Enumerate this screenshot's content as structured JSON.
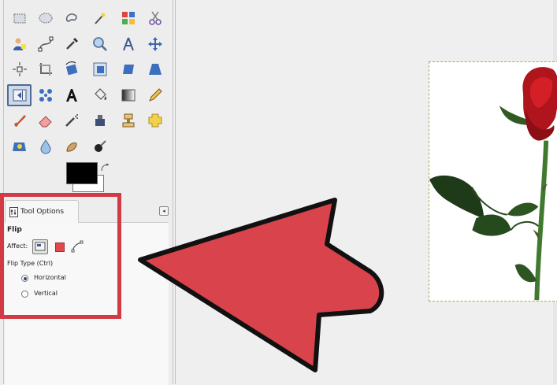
{
  "tool_options": {
    "tab_label": "Tool Options",
    "tool_name": "Flip",
    "affect_label": "Affect:",
    "flip_type_label": "Flip Type  (Ctrl)",
    "options": [
      {
        "label": "Horizontal",
        "selected": true
      },
      {
        "label": "Vertical",
        "selected": false
      }
    ]
  },
  "toolbox": {
    "selected_tool": "flip-tool",
    "foreground_color": "#000000",
    "background_color": "#ffffff"
  },
  "highlight": {
    "box_color": "#d23a44",
    "arrow_color": "#d9444c"
  }
}
